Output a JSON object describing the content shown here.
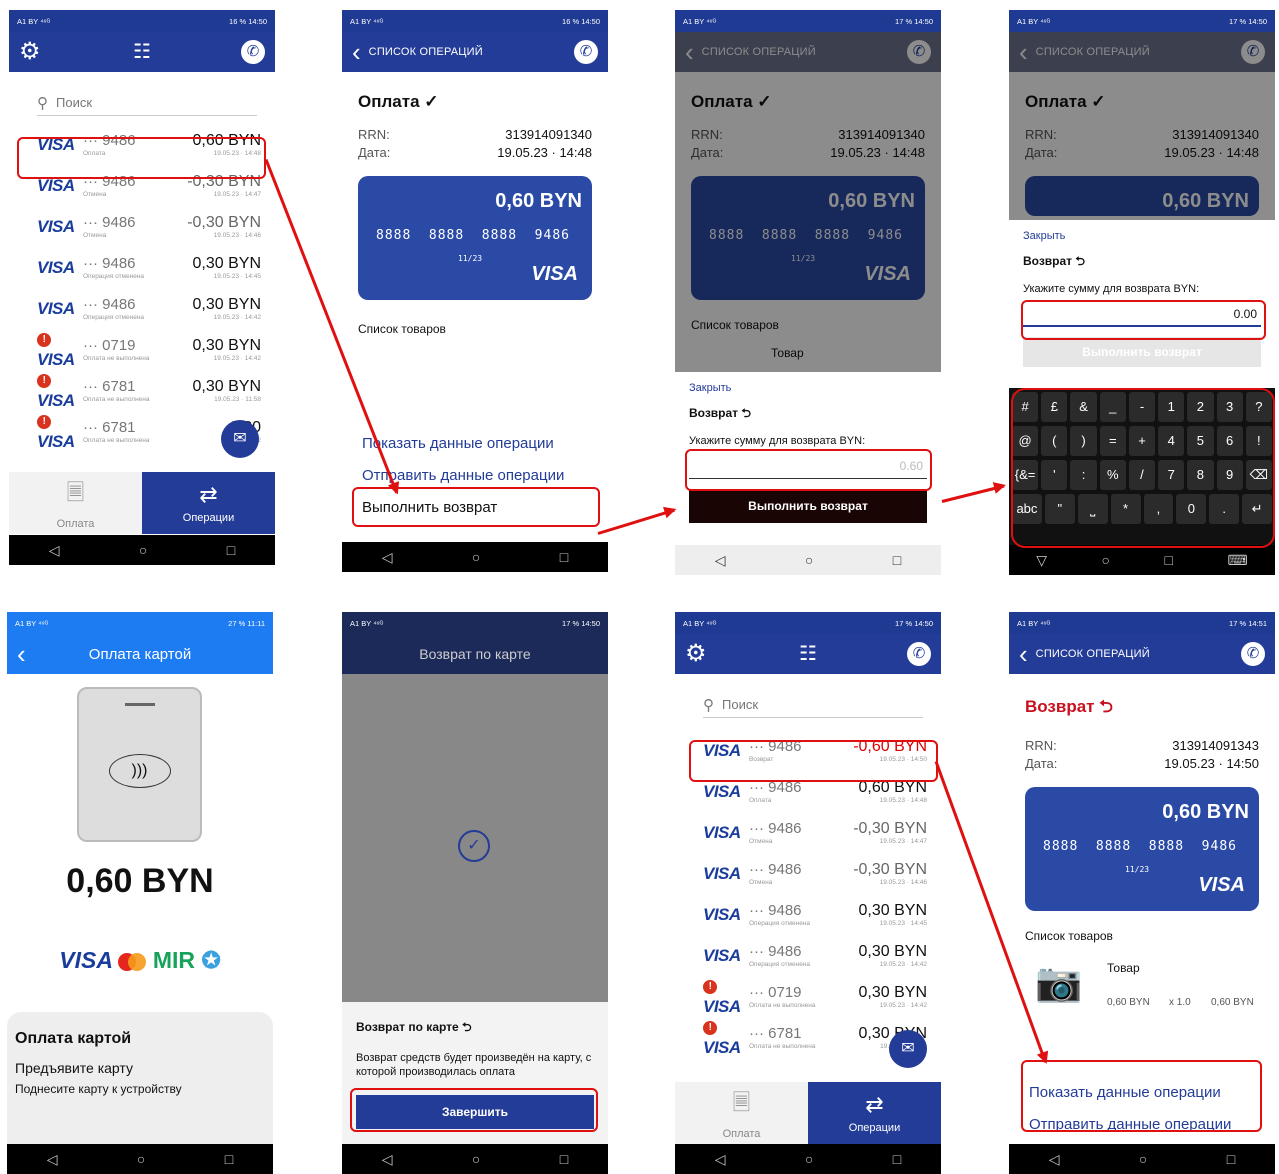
{
  "status": {
    "left": "A1 BY ⁴⁶ᴳ",
    "s1": "16 %  14:50",
    "s2": "16 %  14:50",
    "s3": "17 %  14:50",
    "s4": "17 %  14:50",
    "s5": "27 %  11:11",
    "s6": "17 %  14:50",
    "s7": "17 %  14:50",
    "s8": "17 %  14:51"
  },
  "icons": {
    "gear": "gear-icon",
    "sliders": "sliders-icon",
    "phone": "phone-icon",
    "back": "back-chevron-icon",
    "search": "search-icon",
    "mail": "mail-icon",
    "receipt": "receipt-icon",
    "arrows": "swap-arrows-icon",
    "camera": "camera-icon",
    "undo": "undo-arrow-icon"
  },
  "colors": {
    "brand": "#233c97",
    "highlight": "#e01010",
    "error": "#d9321f",
    "refund_amount": "#d00"
  },
  "list": {
    "search_placeholder": "Поиск",
    "tab_pay": "Оплата",
    "tab_ops": "Операции",
    "ops": [
      {
        "brand": "VISA",
        "num": "··· 9486",
        "status": "Оплата",
        "amount": "0,60 BYN",
        "date": "19.05.23 · 14:48"
      },
      {
        "brand": "VISA",
        "num": "··· 9486",
        "status": "Отмена",
        "amount": "-0,30 BYN",
        "date": "19.05.23 · 14:47"
      },
      {
        "brand": "VISA",
        "num": "··· 9486",
        "status": "Отмена",
        "amount": "-0,30 BYN",
        "date": "19.05.23 · 14:46"
      },
      {
        "brand": "VISA",
        "num": "··· 9486",
        "status": "Операция отменена",
        "amount": "0,30 BYN",
        "date": "19.05.23 · 14:45"
      },
      {
        "brand": "VISA",
        "num": "··· 9486",
        "status": "Операция отменена",
        "amount": "0,30 BYN",
        "date": "19.05.23 · 14:42"
      },
      {
        "brand": "VISA",
        "num": "··· 0719",
        "status": "Оплата не выполнена",
        "amount": "0,30 BYN",
        "date": "19.05.23 · 14:42"
      },
      {
        "brand": "VISA",
        "num": "··· 6781",
        "status": "Оплата не выполнена",
        "amount": "0,30 BYN",
        "date": "19.05.23 · 11:58"
      },
      {
        "brand": "VISA",
        "num": "··· 6781",
        "status": "Оплата не выполнена",
        "amount": "0,30",
        "date": "19.05.2"
      }
    ],
    "refund_op": {
      "brand": "VISA",
      "num": "··· 9486",
      "status": "Возврат",
      "amount": "-0,60 BYN",
      "date": "19.05.23 · 14:50"
    }
  },
  "detail": {
    "header": "СПИСОК ОПЕРАЦИЙ",
    "title": "Оплата ✓",
    "rrn_label": "RRN:",
    "rrn": "313914091340",
    "date_label": "Дата:",
    "date": "19.05.23 · 14:48",
    "card_amount": "0,60 BYN",
    "card_mask": [
      "8888",
      "8888",
      "8888",
      "9486"
    ],
    "card_exp": "11/23",
    "card_brand": "VISA",
    "goods": "Список товаров",
    "goods_item_cut": "Товар",
    "link_show": "Показать данные операции",
    "link_send": "Отправить данные операции",
    "link_refund": "Выполнить возврат"
  },
  "refund_sheet": {
    "close": "Закрыть",
    "title": "Возврат ⮌",
    "label": "Укажите сумму для возврата BYN:",
    "placeholder": "0.60",
    "value": "0.00",
    "button": "Выполнить возврат"
  },
  "keyboard": {
    "rows": [
      [
        "#",
        "£",
        "&",
        "_",
        "-",
        "1",
        "2",
        "3",
        "?"
      ],
      [
        "@",
        "(",
        ")",
        "=",
        "+",
        "4",
        "5",
        "6",
        "!"
      ],
      [
        "{&=",
        "'",
        ":",
        "%",
        "/",
        "7",
        "8",
        "9",
        "⌫"
      ],
      [
        "abc",
        "\"",
        "⎵",
        "*",
        ",",
        "0",
        ".",
        "↵"
      ]
    ]
  },
  "pay": {
    "header": "Оплата картой",
    "amount": "0,60 BYN",
    "brands": [
      "VISA",
      "MIR"
    ],
    "sheet_title": "Оплата картой",
    "line1": "Предъявите карту",
    "line2": "Поднесите карту к устройству"
  },
  "refund_card": {
    "header": "Возврат по карте",
    "sheet_title": "Возврат по карте ⮌",
    "text": "Возврат средств будет произведён на карту, с которой производилась оплата",
    "button": "Завершить"
  },
  "refund_detail": {
    "header": "СПИСОК ОПЕРАЦИЙ",
    "title": "Возврат ⮌",
    "rrn": "313914091343",
    "date": "19.05.23 · 14:50",
    "goods": "Список товаров",
    "item": "Товар",
    "price": "0,60 BYN",
    "qty": "x 1.0",
    "total": "0,60 BYN",
    "link_show": "Показать данные операции",
    "link_send": "Отправить данные операции"
  },
  "nav": {
    "back": "◁",
    "home": "○",
    "recent": "□"
  }
}
